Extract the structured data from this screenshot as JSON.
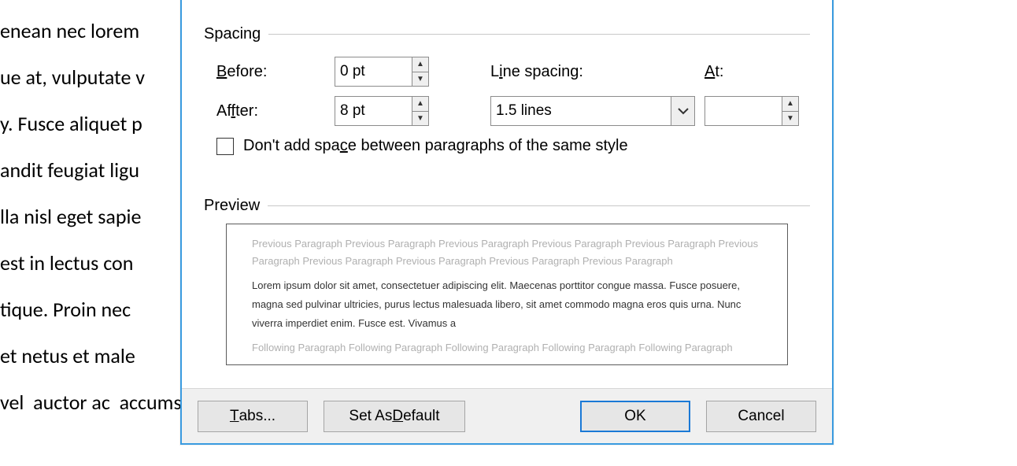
{
  "background_lines": [
    "enean nec lorem                                                                                                       e dui purus,",
    "ue at, vulputate v                                                                                                    enatis eleifend. U",
    "y. Fusce aliquet p                                                                                                    magna. Integer nu",
    "andit feugiat ligu                                                                                                     m pretium metu",
    "lla nisl eget sapie",
    "",
    "est in lectus con                                                                                                     Sed at lorem in n",
    "tique. Proin nec                                                                                                       itant morbi tristi",
    "et netus et male                                                                                                      odio dolor,",
    "vel  auctor ac  accumsan id  felis"
  ],
  "groups": {
    "spacing": {
      "title": "Spacing"
    },
    "preview": {
      "title": "Preview"
    }
  },
  "fields": {
    "before_label": "efore:",
    "before_prefix": "B",
    "after_label": "ter:",
    "after_prefix": "Af",
    "line_spacing_label": "ine spacing:",
    "line_spacing_prefix": "L",
    "at_label": "t:",
    "at_prefix": "A",
    "before_value": "0 pt",
    "after_value": "8 pt",
    "line_spacing_value": "1.5 lines",
    "at_value": ""
  },
  "checkbox": {
    "label_pre": "Don't add spa",
    "label_u": "c",
    "label_post": "e between paragraphs of the same style",
    "checked": false
  },
  "preview": {
    "prev": "Previous Paragraph Previous Paragraph Previous Paragraph Previous Paragraph Previous Paragraph Previous Paragraph Previous Paragraph Previous Paragraph Previous Paragraph Previous Paragraph",
    "sample": "Lorem ipsum dolor sit amet, consectetuer adipiscing elit. Maecenas porttitor congue massa. Fusce posuere, magna sed pulvinar ultricies, purus lectus malesuada libero, sit amet commodo magna eros quis urna. Nunc viverra imperdiet enim. Fusce est. Vivamus a",
    "following": "Following Paragraph Following Paragraph Following Paragraph Following Paragraph Following Paragraph"
  },
  "buttons": {
    "tabs_pre": "",
    "tabs_u": "T",
    "tabs_post": "abs...",
    "default_pre": "Set As ",
    "default_u": "D",
    "default_post": "efault",
    "ok": "OK",
    "cancel": "Cancel"
  }
}
